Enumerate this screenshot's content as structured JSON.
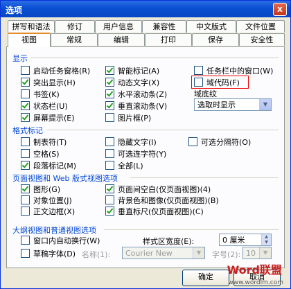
{
  "window": {
    "title": "选项",
    "close_label": "x"
  },
  "tabs_row1": [
    "拼写和语法",
    "修订",
    "用户信息",
    "兼容性",
    "中文版式",
    "文件位置"
  ],
  "tabs_row2": [
    "视图",
    "常规",
    "编辑",
    "打印",
    "保存",
    "安全性"
  ],
  "display": {
    "title": "显示",
    "col1": [
      {
        "label": "启动任务窗格(R)",
        "checked": false
      },
      {
        "label": "突出显示(H)",
        "checked": true
      },
      {
        "label": "书签(K)",
        "checked": false
      },
      {
        "label": "状态栏(U)",
        "checked": true
      },
      {
        "label": "屏幕提示(E)",
        "checked": true
      }
    ],
    "col2": [
      {
        "label": "智能标记(A)",
        "checked": true
      },
      {
        "label": "动态文字(X)",
        "checked": true
      },
      {
        "label": "水平滚动条(Z)",
        "checked": true
      },
      {
        "label": "垂直滚动条(V)",
        "checked": true
      },
      {
        "label": "图片框(P)",
        "checked": false
      }
    ],
    "col3": [
      {
        "label": "任务栏中的窗口(W)",
        "checked": false
      },
      {
        "label": "域代码(F)",
        "checked": false
      }
    ],
    "field_shading_label": "域底纹",
    "field_shading_value": "选取时显示"
  },
  "format_marks": {
    "title": "格式标记",
    "col1": [
      {
        "label": "制表符(T)",
        "checked": false
      },
      {
        "label": "空格(S)",
        "checked": false
      },
      {
        "label": "段落标记(M)",
        "checked": true
      }
    ],
    "col2": [
      {
        "label": "隐藏文字(I)",
        "checked": false
      },
      {
        "label": "可选连字符(Y)",
        "checked": false
      },
      {
        "label": "全部(L)",
        "checked": false
      }
    ],
    "col3": [
      {
        "label": "可选分隔符(O)",
        "checked": false
      }
    ]
  },
  "page_web": {
    "title": "页面视图和 Web 版式视图选项",
    "col1": [
      {
        "label": "图形(G)",
        "checked": true
      },
      {
        "label": "对象位置(J)",
        "checked": false
      },
      {
        "label": "正文边框(X)",
        "checked": false
      }
    ],
    "col2": [
      {
        "label": "页面间空白(仅页面视图)(4)",
        "checked": true
      },
      {
        "label": "背景色和图像(仅页面视图)(B)",
        "checked": false
      },
      {
        "label": "垂直标尺(仅页面视图)(C)",
        "checked": true
      }
    ]
  },
  "outline": {
    "title": "大纲视图和普通视图选项",
    "wrap_label": "窗口内自动换行(W)",
    "wrap_checked": false,
    "draft_label": "草稿字体(D)",
    "draft_checked": false,
    "name_label": "名称(1):",
    "name_value": "Courier New",
    "size_label": "字号(2):",
    "size_value": "10",
    "style_width_label": "样式区宽度(E):",
    "style_width_value": "0 厘米"
  },
  "buttons": {
    "ok": "确定",
    "cancel": "取消"
  },
  "watermark": {
    "brand": "Word联盟",
    "url": "www.wordlm.com"
  }
}
